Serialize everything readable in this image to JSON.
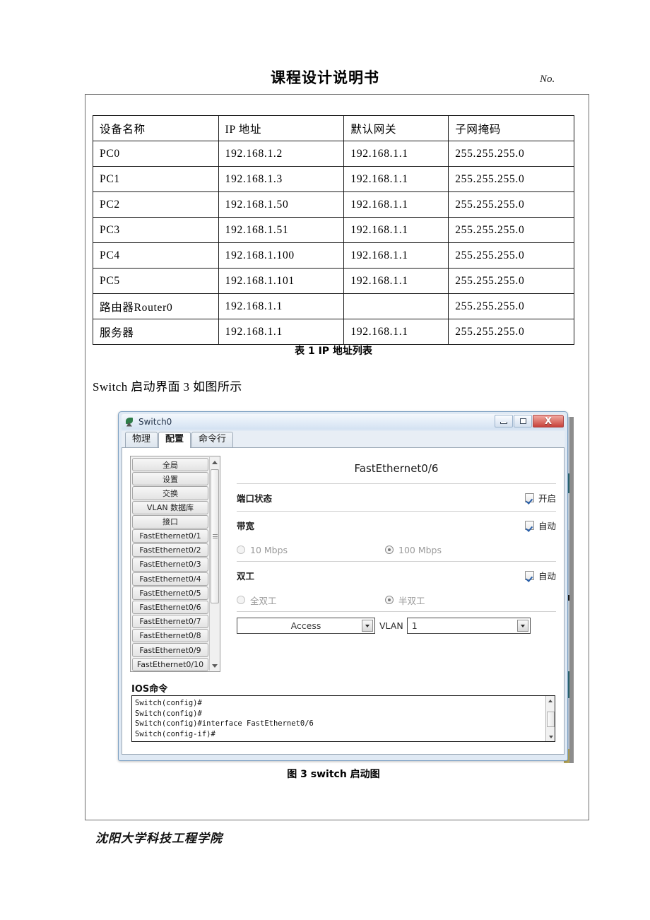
{
  "header": {
    "title": "课程设计说明书",
    "no_label": "No."
  },
  "table": {
    "headers": [
      "设备名称",
      "IP 地址",
      "默认网关",
      "子网掩码"
    ],
    "rows": [
      [
        "PC0",
        "192.168.1.2",
        "192.168.1.1",
        "255.255.255.0"
      ],
      [
        "PC1",
        "192.168.1.3",
        "192.168.1.1",
        "255.255.255.0"
      ],
      [
        "PC2",
        "192.168.1.50",
        "192.168.1.1",
        "255.255.255.0"
      ],
      [
        "PC3",
        "192.168.1.51",
        "192.168.1.1",
        "255.255.255.0"
      ],
      [
        "PC4",
        "192.168.1.100",
        "192.168.1.1",
        "255.255.255.0"
      ],
      [
        "PC5",
        "192.168.1.101",
        "192.168.1.1",
        "255.255.255.0"
      ],
      [
        "路由器Router0",
        "192.168.1.1",
        "",
        "255.255.255.0"
      ],
      [
        "服务器",
        "192.168.1.1",
        "192.168.1.1",
        "255.255.255.0"
      ]
    ],
    "caption": "表 1  IP 地址列表"
  },
  "body_text": "Switch 启动界面 3 如图所示",
  "pt_window": {
    "icon": "packet-tracer-leaf-icon",
    "title": "Switch0",
    "window_buttons": {
      "minimize": "minimize-icon",
      "maximize": "maximize-icon",
      "close": "X"
    },
    "tabs": [
      {
        "label": "物理",
        "active": false
      },
      {
        "label": "配置",
        "active": true
      },
      {
        "label": "命令行",
        "active": false
      }
    ],
    "sidebar": {
      "items": [
        "全局",
        "设置",
        "交换",
        "VLAN 数据库",
        "接口",
        "FastEthernet0/1",
        "FastEthernet0/2",
        "FastEthernet0/3",
        "FastEthernet0/4",
        "FastEthernet0/5",
        "FastEthernet0/6",
        "FastEthernet0/7",
        "FastEthernet0/8",
        "FastEthernet0/9",
        "FastEthernet0/10"
      ],
      "scroll_up_icon": "chevron-up-icon",
      "scroll_down_icon": "chevron-down-icon"
    },
    "config": {
      "interface_title": "FastEthernet0/6",
      "port_status": {
        "label": "端口状态",
        "checkbox_label": "开启",
        "checked": true
      },
      "bandwidth": {
        "label": "带宽",
        "auto_label": "自动",
        "auto_checked": true,
        "options": [
          {
            "label": "10 Mbps",
            "selected": false
          },
          {
            "label": "100 Mbps",
            "selected": true
          }
        ]
      },
      "duplex": {
        "label": "双工",
        "auto_label": "自动",
        "auto_checked": true,
        "options": [
          {
            "label": "全双工",
            "selected": false
          },
          {
            "label": "半双工",
            "selected": true
          }
        ]
      },
      "mode_select": {
        "value": "Access",
        "arrow_icon": "dropdown-arrow-icon"
      },
      "vlan": {
        "label": "VLAN",
        "value": "1",
        "arrow_icon": "dropdown-arrow-icon"
      }
    },
    "ios": {
      "label": "IOS命令",
      "lines": "Switch(config)#\nSwitch(config)#\nSwitch(config)#interface FastEthernet0/6\nSwitch(config-if)#",
      "scroll_up_icon": "chevron-up-icon",
      "scroll_down_icon": "chevron-down-icon"
    }
  },
  "figure_caption": "图 3 switch 启动图",
  "footer": "沈阳大学科技工程学院",
  "colors": {
    "close_button": "#c7413a",
    "checkmark": "#2a5fa8",
    "window_border": "#7a9ec1"
  }
}
